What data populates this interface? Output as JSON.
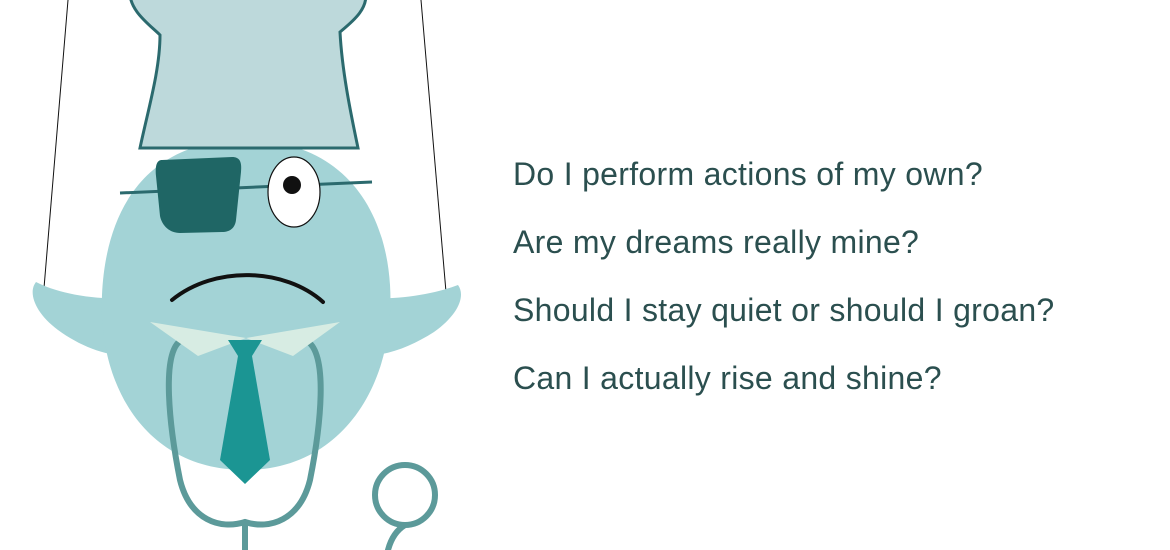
{
  "colors": {
    "body": "#a3d3d6",
    "hat": "#bdd9db",
    "hat_outline": "#2b6a6e",
    "eyepatch": "#1f6665",
    "tie": "#1b9593",
    "collar": "#d7ece3",
    "stethoscope": "#5c9a9a",
    "text": "#2b4f4f"
  },
  "illustration": {
    "subject": "puppet-doctor-character",
    "parts": [
      "puppet-strings",
      "chef-hat",
      "eyepatch",
      "eye",
      "frown",
      "collar",
      "tie",
      "stethoscope"
    ]
  },
  "questions": [
    "Do I perform actions of my own?",
    "Are my dreams really mine?",
    "Should I stay quiet or should I groan?",
    "Can I actually rise and shine?"
  ]
}
